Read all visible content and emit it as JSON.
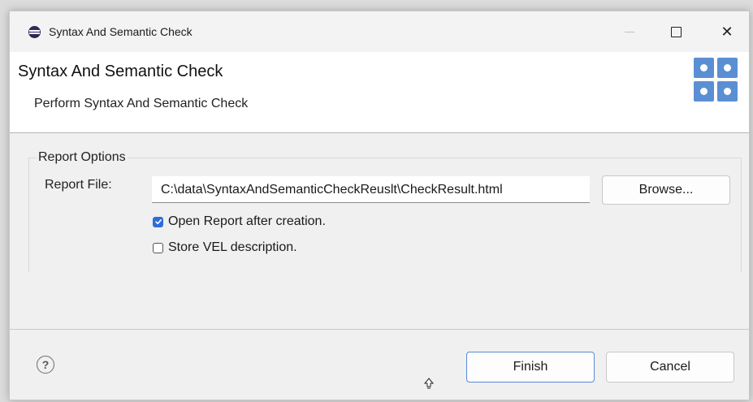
{
  "window": {
    "title": "Syntax And Semantic Check",
    "minimize_icon": "minimize-icon",
    "maximize_icon": "maximize-icon",
    "close_icon": "close-icon",
    "close_glyph": "✕"
  },
  "header": {
    "title": "Syntax And Semantic Check",
    "description": "Perform Syntax And Semantic Check",
    "banner_icon": "wizard-banner-icon",
    "accent_color": "#5b8fd4"
  },
  "report_options": {
    "group_label": "Report Options",
    "report_file_label": "Report File:",
    "report_file_value": "C:\\data\\SyntaxAndSemanticCheckReuslt\\CheckResult.html",
    "browse_label": "Browse...",
    "open_report": {
      "label": "Open Report after creation.",
      "checked": true
    },
    "store_vel": {
      "label": "Store VEL description.",
      "checked": false
    }
  },
  "footer": {
    "help_glyph": "?",
    "finish_label": "Finish",
    "cancel_label": "Cancel"
  }
}
